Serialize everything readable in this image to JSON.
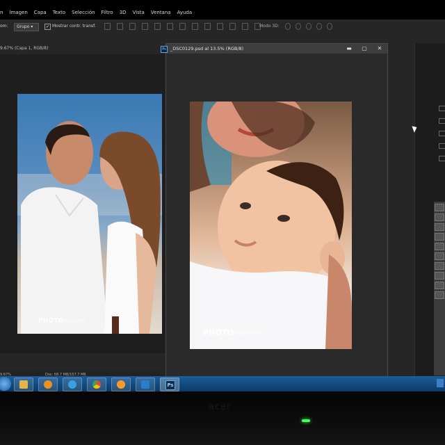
{
  "menu": [
    "n",
    "Imagen",
    "Capa",
    "Texto",
    "Selección",
    "Filtro",
    "3D",
    "Vista",
    "Ventana",
    "Ayuda"
  ],
  "options": {
    "field_left": "om:",
    "group_label": "Grupo",
    "group_value": "Grupo",
    "checkbox_label": "Mostrar contr. transf.",
    "mode3d": "Modo 3D:"
  },
  "left_doc": {
    "tab_label": "9.67% (Capa 1, RGB/8)",
    "status": "9.67%",
    "watermark_bold": "PHOTO",
    "watermark_light": "eleven"
  },
  "doc_window": {
    "title": "_DSC0129.psd al 13.5% (RGB/8)",
    "icon": "Ps",
    "controls": [
      "minimize",
      "maximize",
      "close"
    ],
    "status": "Doc: 68.7 MB/157.7 MB",
    "watermark_bold": "PHOTO",
    "watermark_light": "eleven"
  },
  "taskbar": {
    "apps": [
      {
        "name": "explorer",
        "color": "#e7b449"
      },
      {
        "name": "media-player",
        "color": "#f18f1d"
      },
      {
        "name": "internet-explorer",
        "color": "#3aa0e0"
      },
      {
        "name": "chrome",
        "color": "#e5463c"
      },
      {
        "name": "app-hand",
        "color": "#ff9a2a"
      },
      {
        "name": "app-cloud",
        "color": "#2a7ec9"
      },
      {
        "name": "photoshop",
        "color": "#0f2a4a"
      }
    ],
    "ps_label": "Ps"
  },
  "monitor": {
    "brand": "acer"
  },
  "colors": {
    "accent": "#1b5e9c",
    "led": "#47ff5a"
  }
}
